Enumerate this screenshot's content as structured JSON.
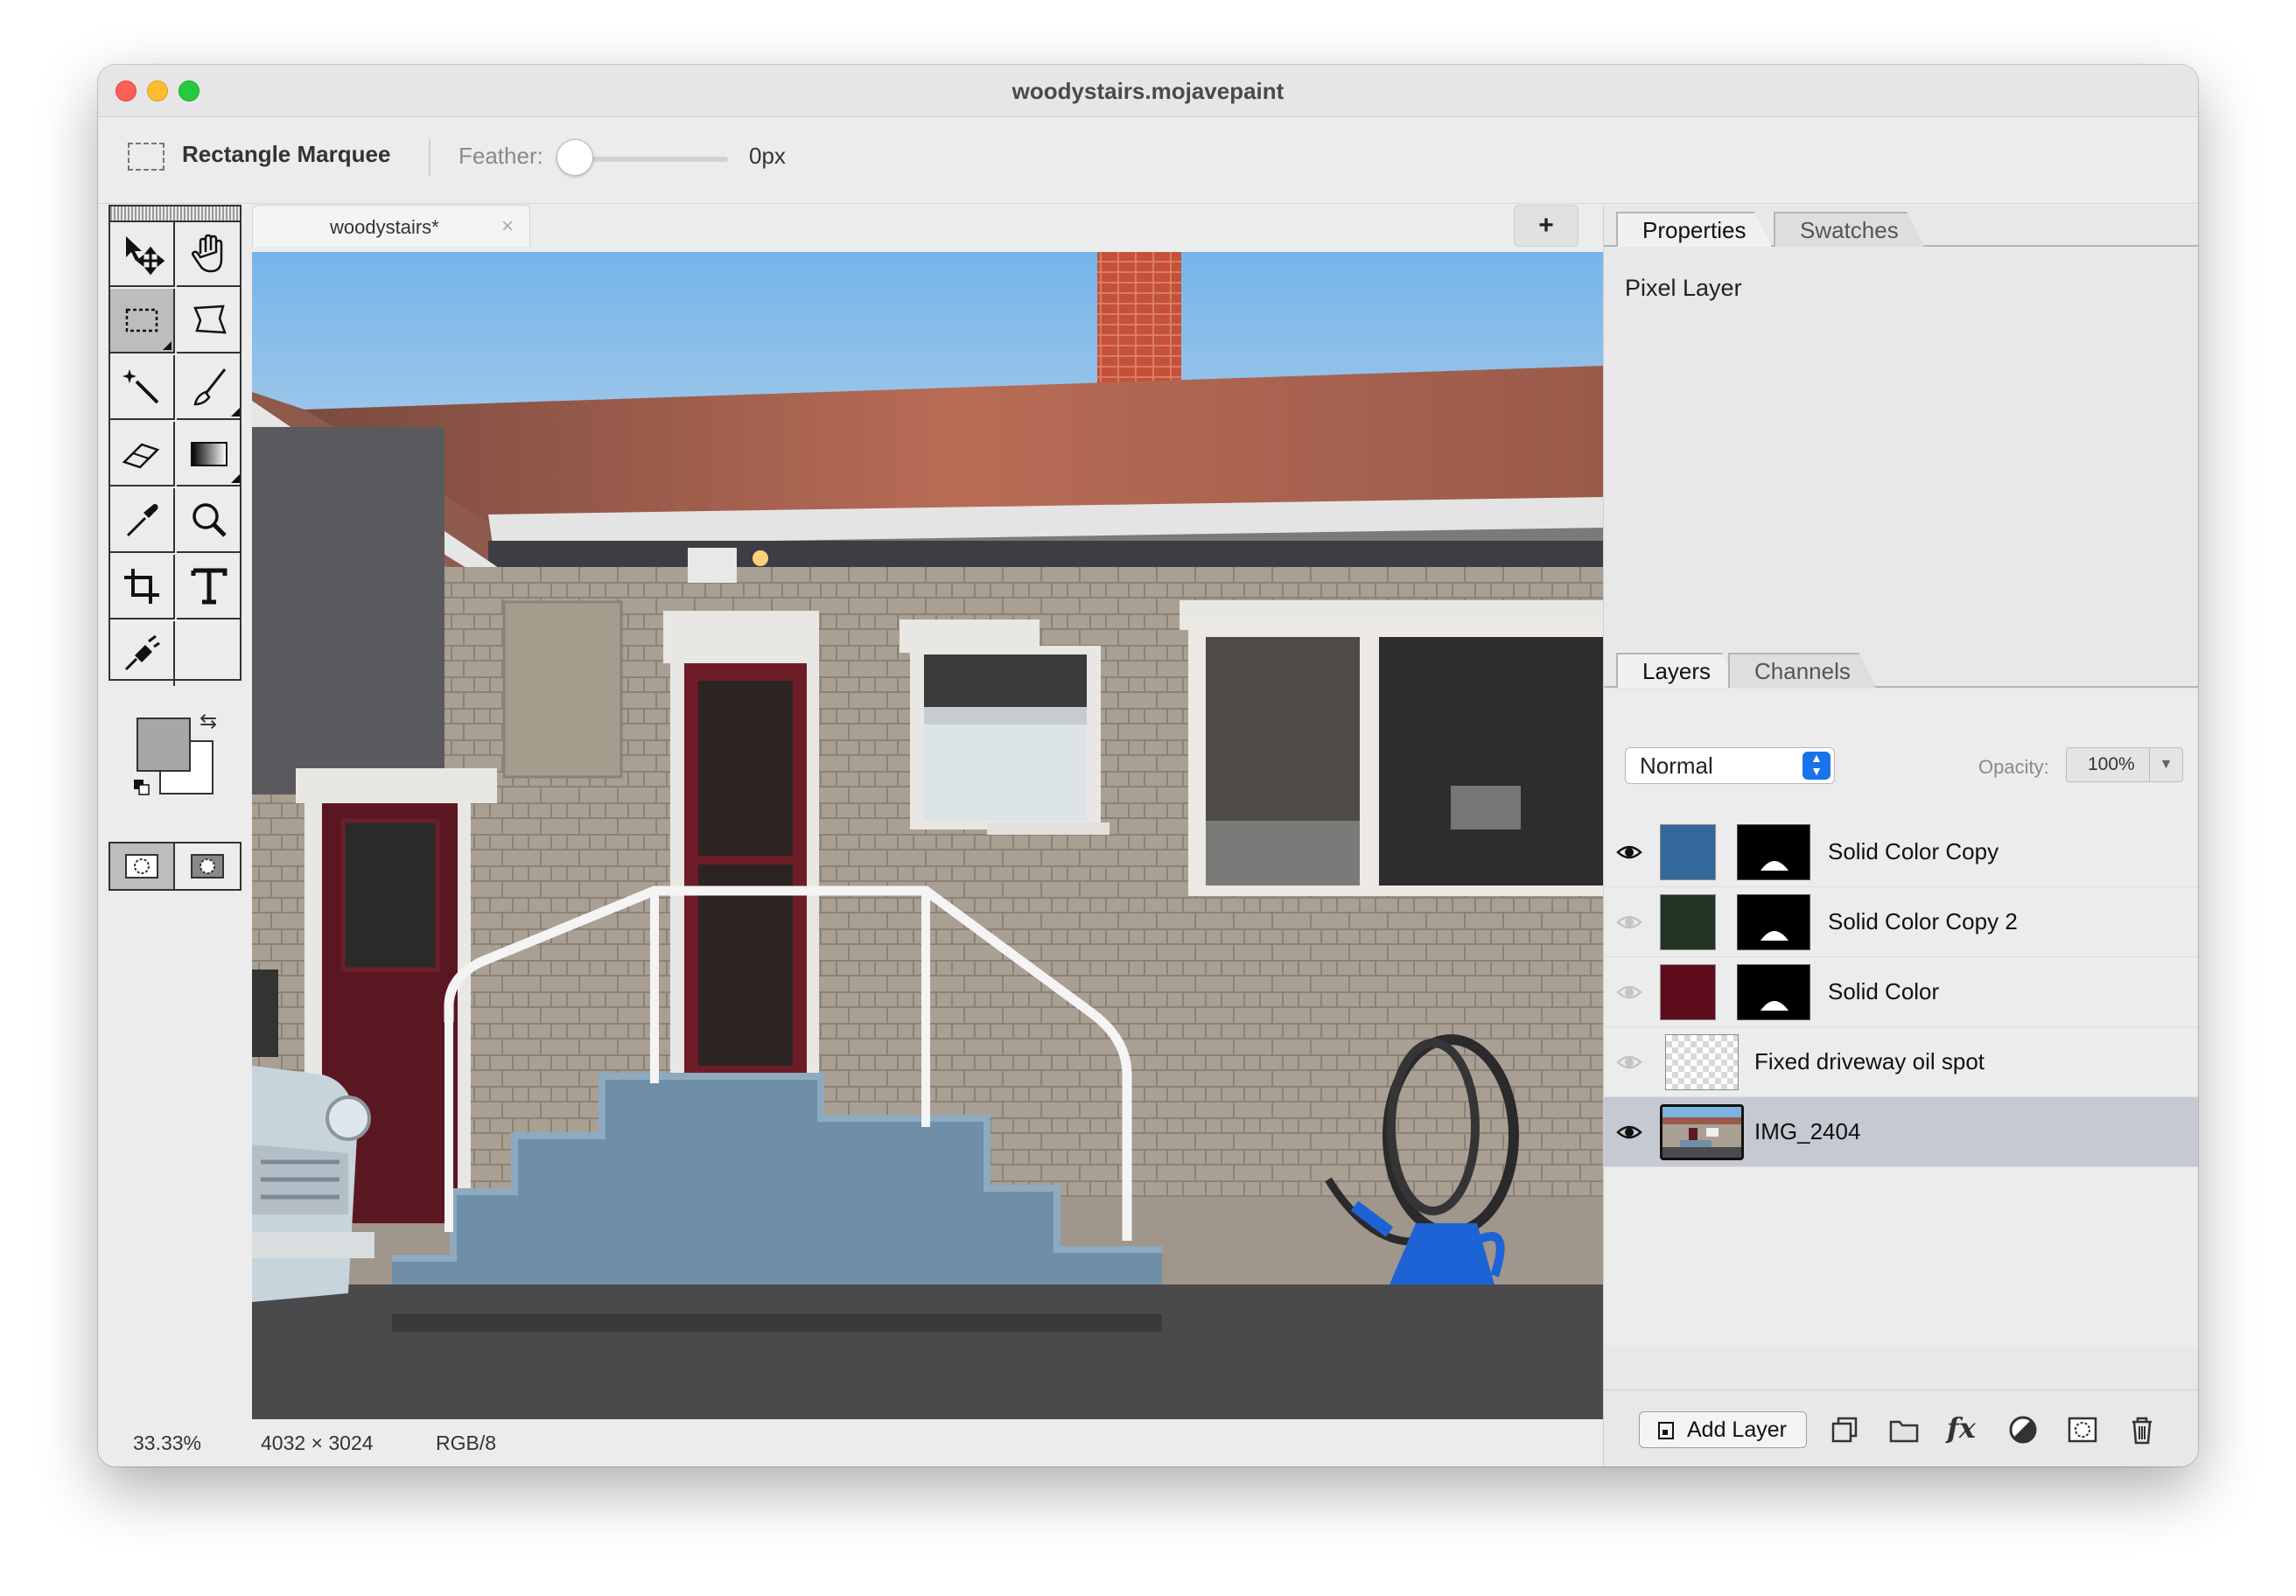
{
  "window": {
    "title": "woodystairs.mojavepaint"
  },
  "options_bar": {
    "tool_name": "Rectangle Marquee",
    "feather_label": "Feather:",
    "feather_value": "0px",
    "feather_level": 0
  },
  "toolbox": {
    "tools": [
      {
        "name": "move-tool",
        "icon": "move-icon"
      },
      {
        "name": "hand-tool",
        "icon": "hand-icon"
      },
      {
        "name": "rectangle-marquee-tool",
        "icon": "rectangle-marquee-icon",
        "selected": true
      },
      {
        "name": "lasso-tool",
        "icon": "lasso-icon"
      },
      {
        "name": "magic-wand-tool",
        "icon": "magic-wand-icon"
      },
      {
        "name": "brush-tool",
        "icon": "brush-icon"
      },
      {
        "name": "eraser-tool",
        "icon": "eraser-icon"
      },
      {
        "name": "gradient-tool",
        "icon": "gradient-icon"
      },
      {
        "name": "eyedropper-tool",
        "icon": "eyedropper-icon"
      },
      {
        "name": "zoom-tool",
        "icon": "magnifier-icon"
      },
      {
        "name": "crop-tool",
        "icon": "crop-icon"
      },
      {
        "name": "text-tool",
        "icon": "text-icon"
      },
      {
        "name": "clone-tool",
        "icon": "clone-stamp-icon"
      }
    ],
    "foreground_color": "#a7a7a7",
    "background_color": "#ffffff"
  },
  "document_tab": {
    "label": "woodystairs",
    "modified_marker": "*",
    "new_tab_label": "+"
  },
  "status_bar": {
    "zoom": "33.33%",
    "dimensions": "4032 × 3024",
    "mode": "RGB/8"
  },
  "properties_panel": {
    "tabs": [
      {
        "label": "Properties",
        "active": true
      },
      {
        "label": "Swatches",
        "active": false
      }
    ],
    "content": "Pixel Layer"
  },
  "layers_panel": {
    "tabs": [
      {
        "label": "Layers",
        "active": true
      },
      {
        "label": "Channels",
        "active": false
      }
    ],
    "blend_mode": "Normal",
    "opacity_label": "Opacity:",
    "opacity_value": "100%",
    "layers": [
      {
        "name": "Solid Color Copy",
        "visible": true,
        "color": "#33689a",
        "has_mask": true
      },
      {
        "name": "Solid Color Copy 2",
        "visible": false,
        "color": "#223326",
        "has_mask": true
      },
      {
        "name": "Solid Color",
        "visible": false,
        "color": "#5e0d1c",
        "has_mask": true
      },
      {
        "name": "Fixed driveway oil spot",
        "visible": false,
        "color": "transparent",
        "has_mask": false
      },
      {
        "name": "IMG_2404",
        "visible": true,
        "color": "photo",
        "has_mask": false,
        "selected": true
      }
    ],
    "add_layer_label": "Add Layer",
    "actions": [
      "duplicate-layer-icon",
      "folder-icon",
      "fx-icon",
      "adjustment-icon",
      "layer-mask-icon",
      "trash-icon"
    ]
  }
}
